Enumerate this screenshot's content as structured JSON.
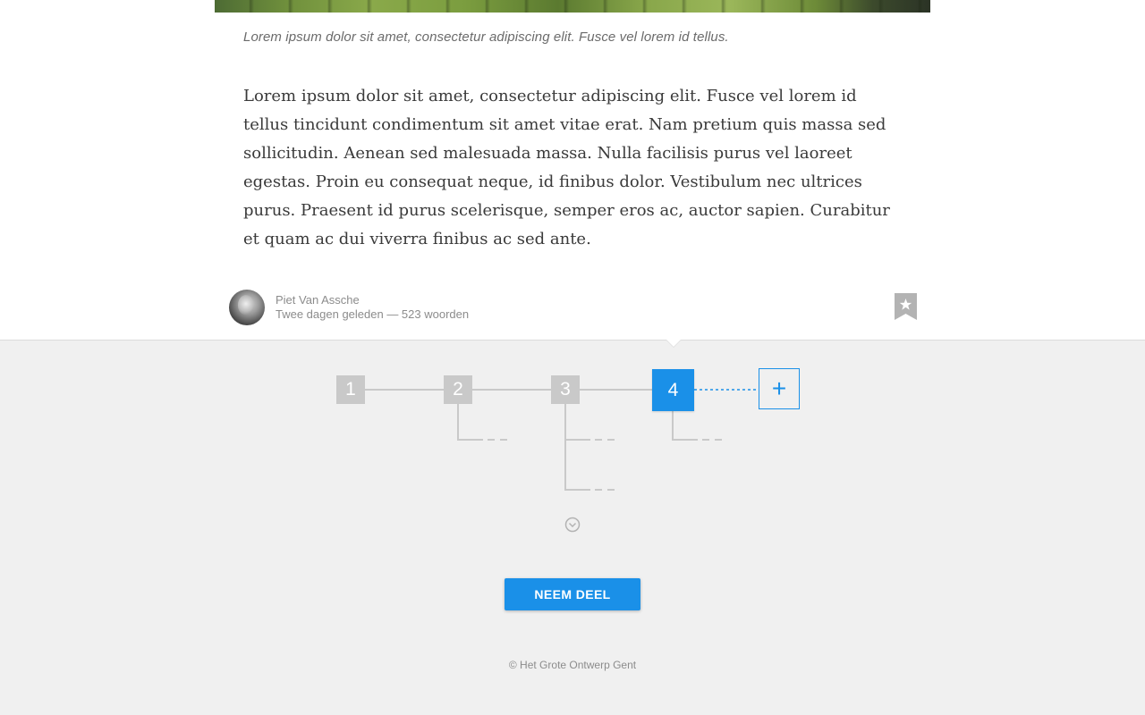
{
  "article": {
    "caption": "Lorem ipsum dolor sit amet, consectetur adipiscing elit. Fusce vel lorem id tellus.",
    "body": "Lorem ipsum dolor sit amet, consectetur adipiscing elit. Fusce vel lorem id tellus tincidunt condimentum sit amet vitae erat. Nam pretium quis massa sed sollicitudin. Aenean sed malesuada massa. Nulla facilisis purus vel laoreet egestas. Proin eu consequat neque, id finibus dolor. Vestibulum nec ultrices purus. Praesent id purus scelerisque, semper eros ac, auctor sapien. Curabitur et quam ac dui viverra finibus ac sed ante."
  },
  "author": {
    "name": "Piet Van Assche",
    "meta": "Twee dagen geleden — 523 woorden"
  },
  "icons": {
    "bookmark": "star-bookmark-icon",
    "add": "plus-icon",
    "more": "chevron-down-circle-icon"
  },
  "flow": {
    "steps": [
      {
        "label": "1",
        "state": "done"
      },
      {
        "label": "2",
        "state": "done"
      },
      {
        "label": "3",
        "state": "done"
      },
      {
        "label": "4",
        "state": "active"
      }
    ],
    "add_label": "+"
  },
  "cta": {
    "label": "NEEM DEEL"
  },
  "footer": {
    "text": "© Het Grote Ontwerp Gent"
  },
  "colors": {
    "accent": "#1a90e8",
    "step_done": "#c9c9c9",
    "background": "#f0f0f0"
  }
}
